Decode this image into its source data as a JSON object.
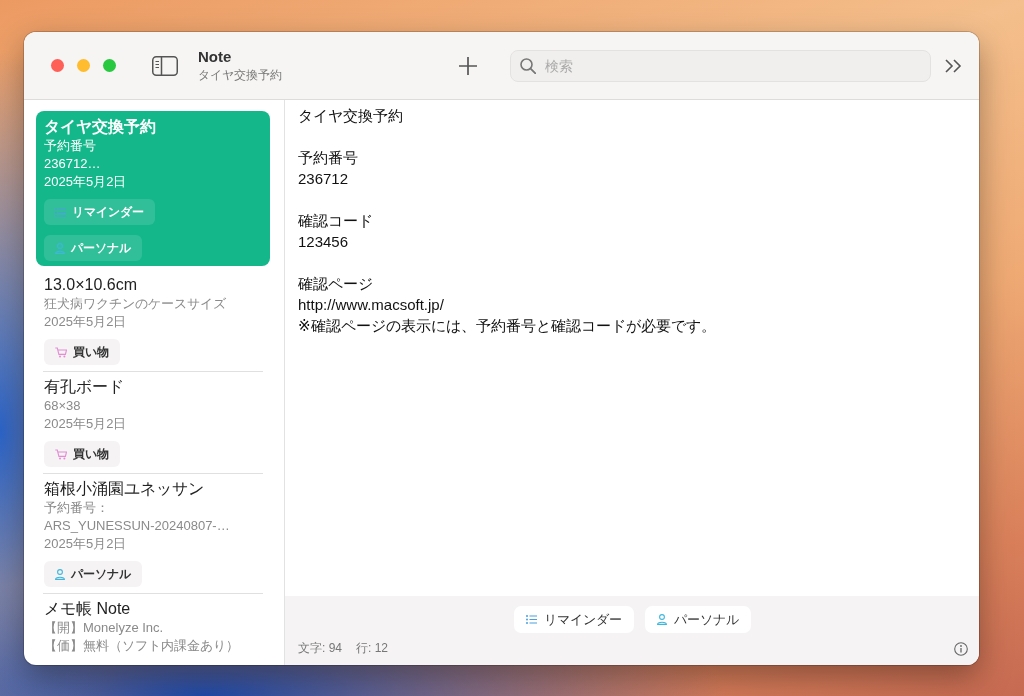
{
  "window": {
    "title": "Note",
    "subtitle": "タイヤ交換予約"
  },
  "toolbar": {
    "search": {
      "placeholder": "検索"
    }
  },
  "sidebar": {
    "notes": [
      {
        "title": "タイヤ交換予約",
        "preview": [
          "予約番号",
          "236712…"
        ],
        "date": "2025年5月2日",
        "tags": [
          {
            "kind": "reminder",
            "label": "リマインダー"
          },
          {
            "kind": "personal",
            "label": "パーソナル"
          }
        ],
        "selected": true
      },
      {
        "title": "13.0×10.6cm",
        "preview": [
          "狂犬病ワクチンのケースサイズ"
        ],
        "date": "2025年5月2日",
        "tags": [
          {
            "kind": "shopping",
            "label": "買い物"
          }
        ],
        "selected": false
      },
      {
        "title": "有孔ボード",
        "preview": [
          "68×38"
        ],
        "date": "2025年5月2日",
        "tags": [
          {
            "kind": "shopping",
            "label": "買い物"
          }
        ],
        "selected": false
      },
      {
        "title": "箱根小涌園ユネッサン",
        "preview": [
          "予約番号：",
          "ARS_YUNESSUN-20240807-…"
        ],
        "date": "2025年5月2日",
        "tags": [
          {
            "kind": "personal",
            "label": "パーソナル"
          }
        ],
        "selected": false
      },
      {
        "title": "メモ帳 Note",
        "preview": [
          "【開】Monelyze Inc.",
          "【価】無料（ソフト内課金あり）"
        ],
        "selected": false
      }
    ]
  },
  "editor": {
    "paragraphs": [
      [
        "タイヤ交換予約"
      ],
      [
        "予約番号",
        "236712"
      ],
      [
        "確認コード",
        "123456"
      ],
      [
        "確認ページ",
        "http://www.macsoft.jp/",
        "※確認ページの表示には、予約番号と確認コードが必要です。"
      ]
    ],
    "tags": [
      {
        "kind": "reminder",
        "label": "リマインダー"
      },
      {
        "kind": "personal",
        "label": "パーソナル"
      }
    ],
    "status_bar": {
      "characters": "文字: 94",
      "lines": "行: 12"
    }
  }
}
